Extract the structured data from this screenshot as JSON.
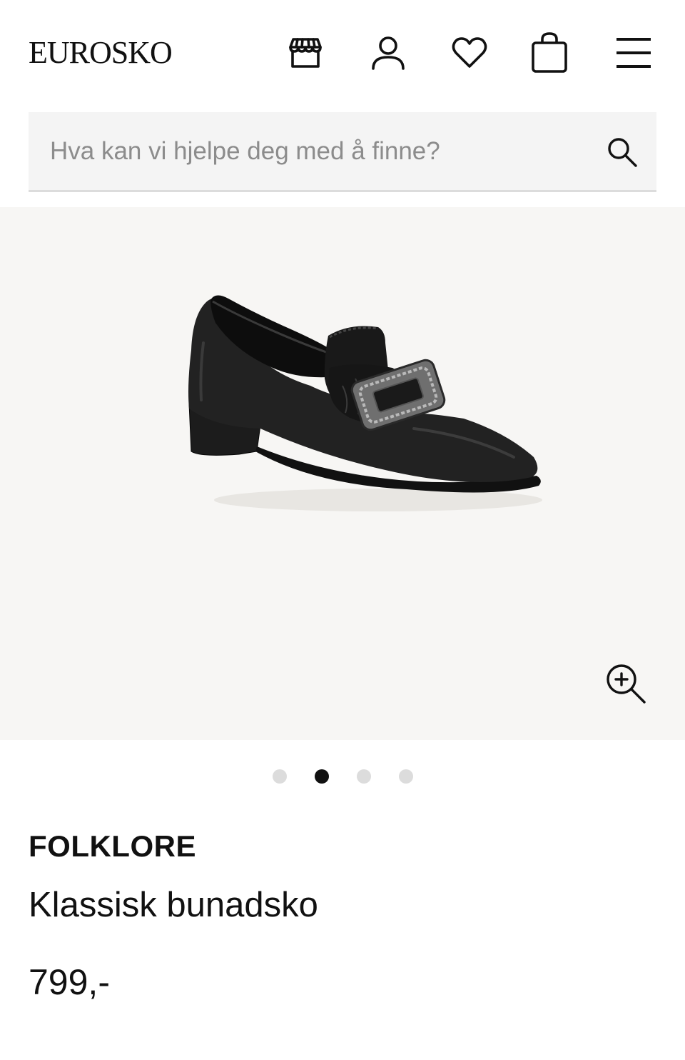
{
  "header": {
    "logo": "EUROSKO",
    "icons": [
      "store-icon",
      "user-icon",
      "heart-icon",
      "bag-icon",
      "menu-icon"
    ]
  },
  "search": {
    "placeholder": "Hva kan vi hjelpe deg med å finne?",
    "value": ""
  },
  "gallery": {
    "image_count": 4,
    "active_index": 1
  },
  "product": {
    "brand": "FOLKLORE",
    "name": "Klassisk bunadsko",
    "price": "799,-"
  },
  "colors": {
    "text": "#111111",
    "search_bg": "#f4f4f4",
    "gallery_bg": "#f7f6f4",
    "dot_inactive": "#dcdcdc",
    "dot_active": "#111111"
  }
}
